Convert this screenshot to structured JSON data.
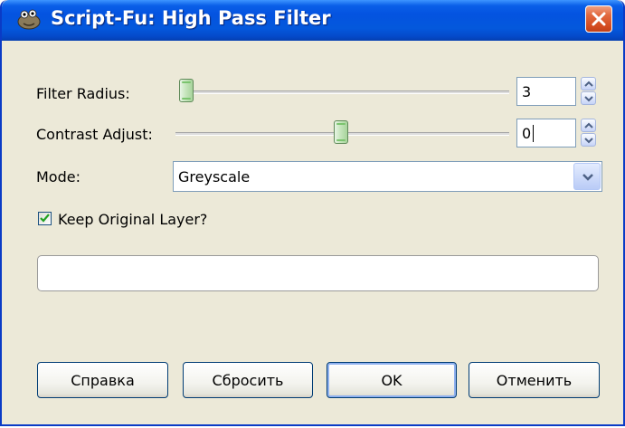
{
  "window": {
    "title": "Script-Fu: High Pass Filter",
    "icon": "gimp-wilber-icon",
    "close_icon": "close-icon"
  },
  "form": {
    "filter_radius": {
      "label": "Filter Radius:",
      "value": "3",
      "slider_fraction": 0.0
    },
    "contrast_adjust": {
      "label": "Contrast Adjust:",
      "value": "0",
      "slider_fraction": 0.5
    },
    "mode": {
      "label": "Mode:",
      "selected": "Greyscale"
    },
    "keep_original": {
      "label": "Keep Original Layer?",
      "checked": true
    }
  },
  "progress": {
    "text": "",
    "value": 0
  },
  "buttons": {
    "help": "Справка",
    "reset": "Сбросить",
    "ok": "OK",
    "cancel": "Отменить"
  },
  "colors": {
    "titlebar": "#0453e0",
    "window_bg": "#ece9d8",
    "close": "#d34b1f",
    "slider_thumb": "#a7d39b"
  }
}
